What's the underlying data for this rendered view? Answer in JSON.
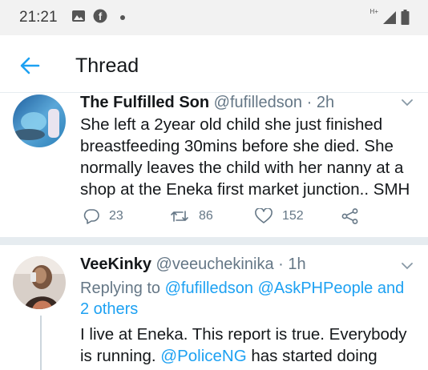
{
  "status_bar": {
    "time": "21:21",
    "network_label": "H+",
    "icons": [
      "image-icon",
      "facebook-icon",
      "notification-dot",
      "signal-icon",
      "battery-icon"
    ]
  },
  "header": {
    "title": "Thread",
    "back_icon": "arrow-left-icon",
    "accent_color": "#1da1f2"
  },
  "tweets": [
    {
      "display_name": "The Fulfilled Son",
      "handle": "@fufilledson",
      "time_sep": " · ",
      "time": "2h",
      "text_lines": [
        "She left a 2year old child she just finished",
        "breastfeeding 30mins before she died. She",
        "normally leaves the child with her nanny at a",
        "shop at the Eneka first market junction.. SMH"
      ],
      "actions": {
        "replies": "23",
        "retweets": "86",
        "likes": "152"
      }
    },
    {
      "display_name": "VeeKinky",
      "handle": "@veeuchekinika",
      "time_sep": " · ",
      "time": "1h",
      "replying_prefix": "Replying to ",
      "replying_to": "@fufilledson",
      "replying_to_2": "@AskPHPeople",
      "replying_and": " and",
      "replying_others": "2 others",
      "text_line_1": "I live at Eneka. This report is true. Everybody",
      "text_line_2_prefix": "is running. ",
      "text_line_2_mention": "@PoliceNG",
      "text_line_2_suffix": " has started doing"
    }
  ]
}
